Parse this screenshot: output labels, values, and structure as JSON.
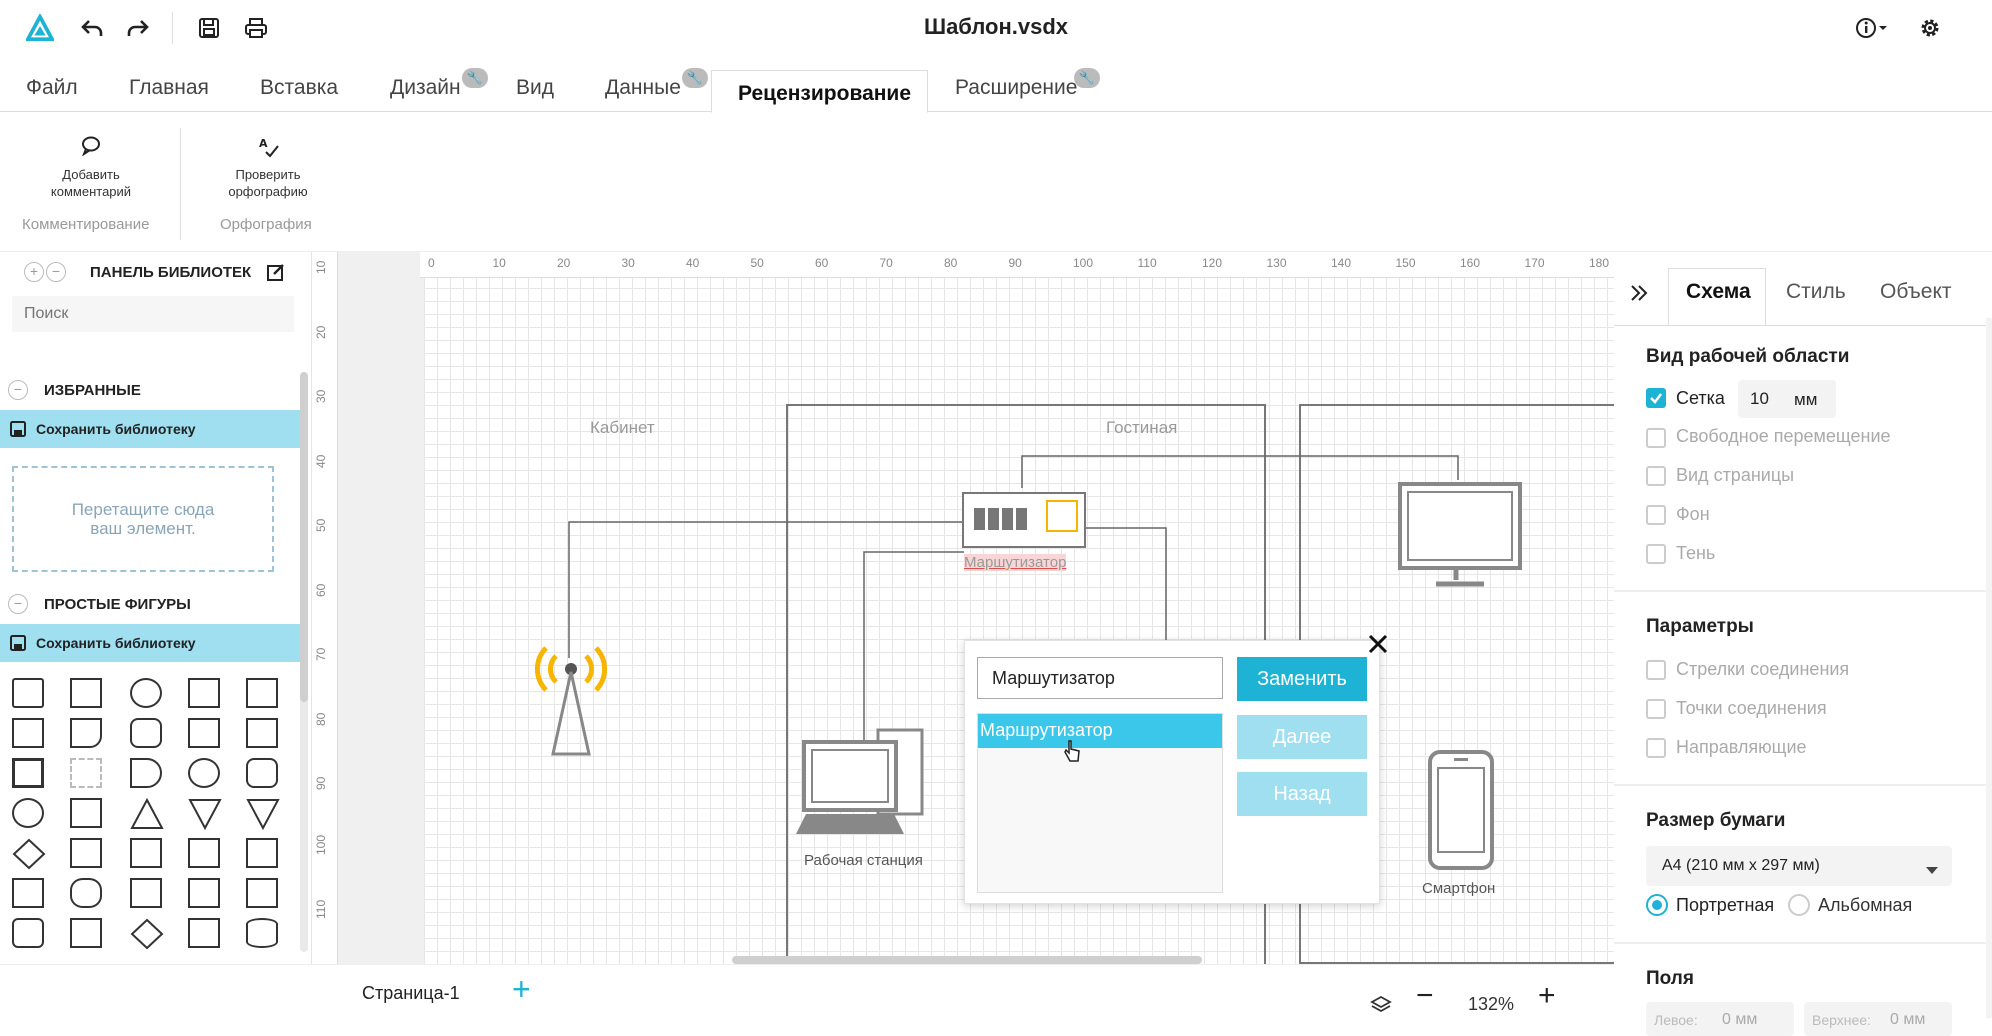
{
  "titlebar": {
    "title": "Шаблон.vsdx",
    "logo_icon": "app-logo-icon",
    "icons": [
      "undo-icon",
      "redo-icon",
      "save-icon",
      "print-icon",
      "info-icon",
      "gear-icon"
    ]
  },
  "menu": {
    "tabs": [
      {
        "label": "Файл"
      },
      {
        "label": "Главная"
      },
      {
        "label": "Вставка"
      },
      {
        "label": "Дизайн"
      },
      {
        "label": "Вид"
      },
      {
        "label": "Данные"
      },
      {
        "label": "Рецензирование"
      },
      {
        "label": "Расширение"
      }
    ],
    "active_tab": "Рецензирование"
  },
  "ribbon": {
    "add_comment": "Добавить комментарий",
    "spell_check": "Проверить орфографию",
    "group_comment": "Комментирование",
    "group_spelling": "Орфография"
  },
  "library": {
    "title": "ПАНЕЛЬ БИБЛИОТЕК",
    "search_placeholder": "Поиск",
    "favorites": "ИЗБРАННЫЕ",
    "save_library": "Сохранить библиотеку",
    "drop_hint_1": "Перетащите сюда",
    "drop_hint_2": "ваш элемент.",
    "basic_shapes": "ПРОСТЫЕ ФИГУРЫ"
  },
  "rulers": {
    "top_ticks": [
      "0",
      "10",
      "20",
      "30",
      "40",
      "50",
      "60",
      "70",
      "80",
      "90",
      "100",
      "110",
      "120",
      "130",
      "140",
      "150",
      "160",
      "170",
      "180"
    ],
    "left_ticks": [
      "10",
      "20",
      "30",
      "40",
      "50",
      "60",
      "70",
      "80",
      "90",
      "100",
      "110"
    ]
  },
  "diagram": {
    "room_office": "Кабинет",
    "room_living": "Гостиная",
    "router_label": "Маршутизатор",
    "workstation_label": "Рабочая станция",
    "smartphone_label": "Смартфон"
  },
  "spell_dialog": {
    "input_value": "Маршутизатор",
    "suggestion": "Маршрутизатор",
    "replace": "Заменить",
    "next": "Далее",
    "back": "Назад"
  },
  "right_panel": {
    "tabs": [
      {
        "label": "Схема"
      },
      {
        "label": "Стиль"
      },
      {
        "label": "Объект"
      }
    ],
    "active_tab": "Схема",
    "workspace_title": "Вид рабочей области",
    "grid": {
      "label": "Сетка",
      "value": "10",
      "unit": "мм",
      "checked": true
    },
    "free_move": "Свободное перемещение",
    "page_view": "Вид страницы",
    "background": "Фон",
    "shadow": "Тень",
    "params_title": "Параметры",
    "arrows": "Стрелки соединения",
    "points": "Точки соединения",
    "guides": "Направляющие",
    "paper_title": "Размер бумаги",
    "paper_value": "A4 (210 мм x 297 мм)",
    "portrait": "Портретная",
    "landscape": "Альбомная",
    "orientation_selected": "Портретная",
    "margins_title": "Поля",
    "left_label": "Левое:",
    "left_value": "0 мм",
    "top_label": "Верхнее:",
    "top_value": "0 мм"
  },
  "bottom": {
    "page_tab": "Страница-1",
    "add_page": "+",
    "zoom": "132%",
    "zoom_out": "−",
    "zoom_in": "+"
  },
  "colors": {
    "accent": "#1eb3d4",
    "accent_light": "#9fdff0",
    "selection": "#3bc7ea",
    "antenna": "#f7b500"
  }
}
